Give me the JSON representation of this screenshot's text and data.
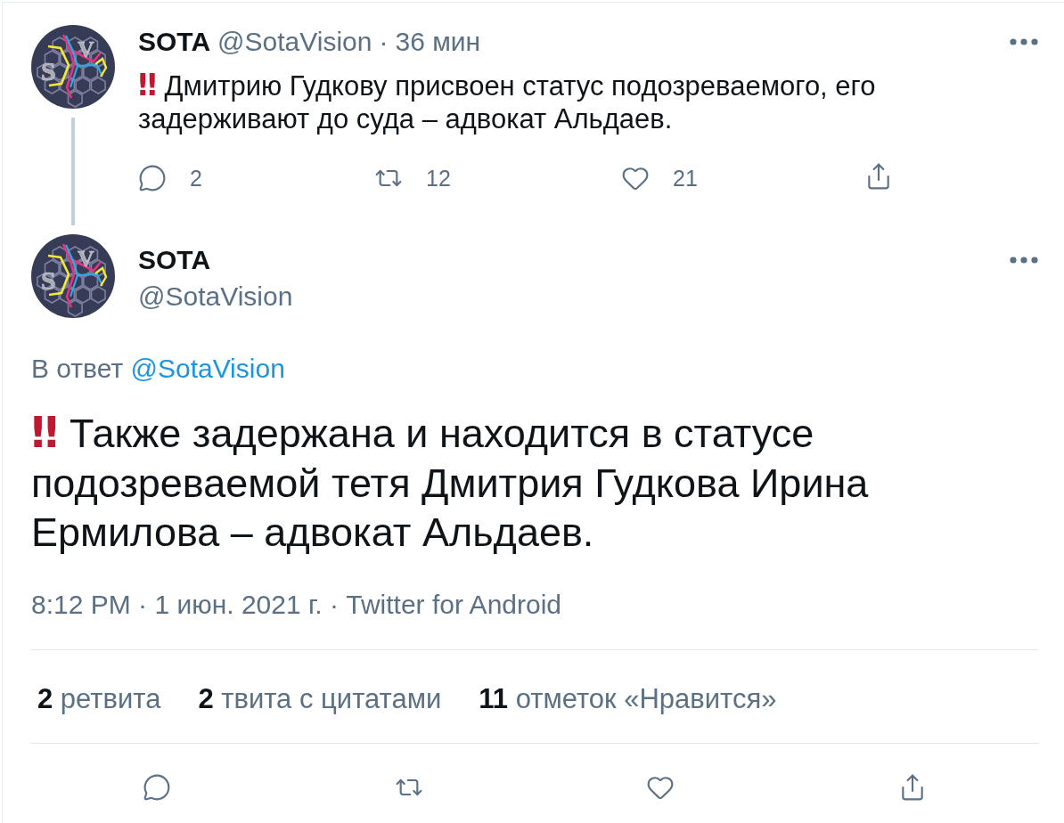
{
  "thread_tweet": {
    "author": {
      "name": "SOTA",
      "handle": "@SotaVision",
      "avatar_letters": [
        "S",
        "V"
      ]
    },
    "separator": "·",
    "time": "36 мин",
    "emoji": "‼",
    "text": "Дмитрию Гудкову присвоен статус подозреваемого, его задерживают до суда – адвокат Альдаев.",
    "actions": [
      {
        "kind": "reply",
        "count": "2"
      },
      {
        "kind": "retweet",
        "count": "12"
      },
      {
        "kind": "like",
        "count": "21"
      },
      {
        "kind": "share"
      }
    ]
  },
  "main_tweet": {
    "author": {
      "name": "SOTA",
      "handle": "@SotaVision",
      "avatar_letters": [
        "S",
        "V"
      ]
    },
    "reply_to": {
      "label": "В ответ",
      "handle": "@SotaVision"
    },
    "emoji": "‼",
    "text": "Также задержана и находится в статусе подозреваемой тетя Дмитрия Гудкова Ирина Ермилова – адвокат Альдаев.",
    "meta": "8:12 PM · 1 июн. 2021 г. · Twitter for Android",
    "stats": [
      "**2** ретвита",
      "**2** твита с цитатами",
      "**11** отметок «Нравится»"
    ],
    "actions": [
      {
        "kind": "reply"
      },
      {
        "kind": "retweet"
      },
      {
        "kind": "like"
      },
      {
        "kind": "share"
      }
    ]
  }
}
